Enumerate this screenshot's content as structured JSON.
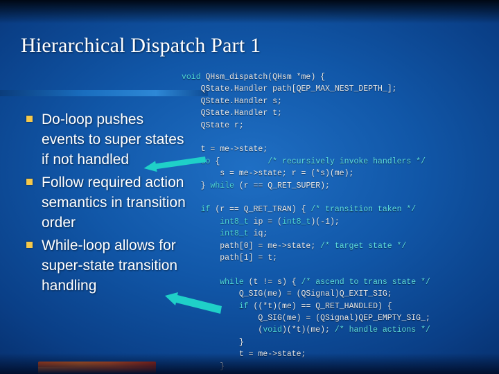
{
  "slide": {
    "title": "Hierarchical Dispatch Part 1",
    "bullets": [
      "Do-loop pushes events to super states if not handled",
      "Follow required action semantics in transition order",
      "While-loop allows for super-state transition handling"
    ],
    "bullet_marker": "square-bullet-icon",
    "code_lines": [
      "void QHsm_dispatch(QHsm *me) {",
      "    QState.Handler path[QEP_MAX_NEST_DEPTH_];",
      "    QState.Handler s;",
      "    QState.Handler t;",
      "    QState r;",
      "",
      "    t = me->state;",
      "    do {          /* recursively invoke handlers */",
      "        s = me->state; r = (*s)(me);",
      "    } while (r == Q_RET_SUPER);",
      "",
      "    if (r == Q_RET_TRAN) { /* transition taken */",
      "        int8_t ip = (int8_t)(-1);",
      "        int8_t iq;",
      "        path[0] = me->state; /* target state */",
      "        path[1] = t;",
      "",
      "        while (t != s) { /* ascend to trans state */",
      "            Q_SIG(me) = (QSignal)Q_EXIT_SIG;",
      "            if ((*t)(me) == Q_RET_HANDLED) {",
      "                Q_SIG(me) = (QSignal)QEP_EMPTY_SIG_;",
      "                (void)(*t)(me); /* handle actions */",
      "            }",
      "            t = me->state;",
      "        }"
    ],
    "colors": {
      "background_top": "#0a3f87",
      "background_mid": "#1f6fc4",
      "title_text": "#ffffff",
      "bullet_marker": "#f5c84a",
      "code_text": "#e8e8e8",
      "code_keyword": "#4fd8d8",
      "arrow": "#1fd0c8",
      "footer_bar": "#ef6a1a"
    },
    "decorations": {
      "title_rule": "title-underline-bar",
      "arrow_1": "pointer-arrow-upper",
      "arrow_2": "pointer-arrow-lower",
      "footer": "footer-accent-bar"
    }
  }
}
